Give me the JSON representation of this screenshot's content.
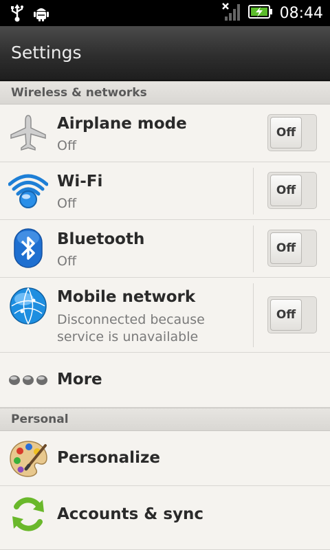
{
  "status_bar": {
    "time": "08:44",
    "icons": [
      "usb-icon",
      "android-debug-icon",
      "no-signal-icon",
      "battery-charging-icon"
    ]
  },
  "title_bar": {
    "title": "Settings"
  },
  "sections": {
    "wireless": "Wireless & networks",
    "personal": "Personal"
  },
  "wireless_items": [
    {
      "label": "Airplane mode",
      "subtitle": "Off",
      "toggle": "Off",
      "icon": "airplane-icon"
    },
    {
      "label": "Wi-Fi",
      "subtitle": "Off",
      "toggle": "Off",
      "icon": "wifi-icon"
    },
    {
      "label": "Bluetooth",
      "subtitle": "Off",
      "toggle": "Off",
      "icon": "bluetooth-icon"
    },
    {
      "label": "Mobile network",
      "subtitle": "Disconnected because service is unavailable",
      "toggle": "Off",
      "icon": "globe-icon"
    },
    {
      "label": "More",
      "icon": "more-dots-icon"
    }
  ],
  "personal_items": [
    {
      "label": "Personalize",
      "icon": "palette-icon"
    },
    {
      "label": "Accounts & sync",
      "icon": "sync-icon"
    }
  ],
  "colors": {
    "background": "#f5f3ef",
    "header_bg": "#dedcd8",
    "title_bar": "#2e2e2e",
    "wifi_blue": "#1e7fd6",
    "sync_green": "#6ab82b"
  }
}
